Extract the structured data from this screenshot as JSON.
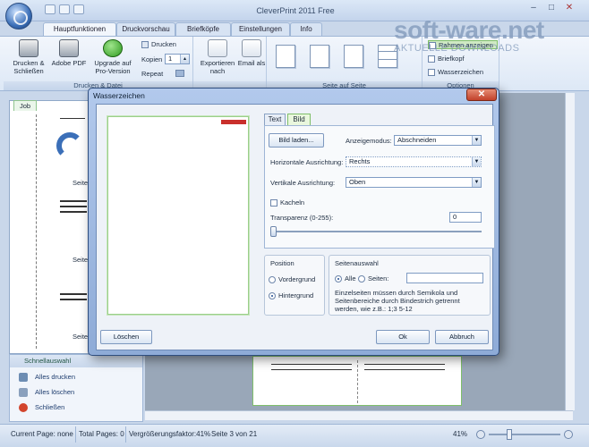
{
  "window": {
    "title": "CleverPrint 2011 Free",
    "controls": [
      "–",
      "□",
      "✕"
    ]
  },
  "ribbon_tabs": [
    "Hauptfunktionen",
    "Druckvorschau",
    "Briefköpfe",
    "Einstellungen",
    "Info"
  ],
  "ribbon": {
    "drucken_schliessen": "Drucken & Schließen",
    "adobe_pdf": "Adobe PDF",
    "upgrade": "Upgrade auf Pro-Version",
    "drucken": "Drucken",
    "kopien_label": "Kopien",
    "kopien_value": "1",
    "repeat": "Repeat",
    "exportieren": "Exportieren nach",
    "email": "Email als",
    "group_drucken": "Drucken & Datei",
    "group_seite": "Seite auf Seite",
    "group_optionen": "Optionen",
    "rahmen": "Rahmen anzeigen",
    "briefkopf": "Briefkopf",
    "wasserzeichen": "Wasserzeichen"
  },
  "brand": {
    "name": "soft-ware.net",
    "sub": "AKTUELLE DOWNLOADS"
  },
  "left_panel": {
    "tab": "Job",
    "page_label_1": "Seite",
    "page_label_2": "Seite",
    "page_label_3": "Seite"
  },
  "schnellauswahl": {
    "title": "Schnellauswahl",
    "items": [
      "Alles drucken",
      "Alles löschen",
      "Schließen"
    ]
  },
  "status": {
    "current_page": "Current Page: none",
    "total_pages": "Total Pages: 0",
    "zoom_factor": "Vergrößerungsfaktor:41%",
    "page_of": "Seite 3 von 21",
    "zoom": "41%"
  },
  "dialog": {
    "title": "Wasserzeichen",
    "tabs": [
      "Text",
      "Bild"
    ],
    "load_button": "Bild laden...",
    "display_mode_label": "Anzeigemodus:",
    "display_mode_value": "Abschneiden",
    "h_align_label": "Horizontale Ausrichtung:",
    "h_align_value": "Rechts",
    "v_align_label": "Vertikale Ausrichtung:",
    "v_align_value": "Oben",
    "tiles_label": "Kacheln",
    "transparency_label": "Transparenz (0-255):",
    "transparency_value": "0",
    "position_title": "Position",
    "pos_front": "Vordergrund",
    "pos_back": "Hintergrund",
    "pages_title": "Seitenauswahl",
    "pages_all": "Alle",
    "pages_custom": "Seiten:",
    "pages_hint": "Einzelseiten müssen durch Semikola und Seitenbereiche durch Bindestrich getrennt werden, wie z.B.: 1;3 5-12",
    "delete_button": "Löschen",
    "ok_button": "Ok",
    "cancel_button": "Abbruch"
  },
  "colors": {
    "accent": "#2e4d7e",
    "active_tab": "#7fbf6a",
    "close": "#c2412a"
  }
}
